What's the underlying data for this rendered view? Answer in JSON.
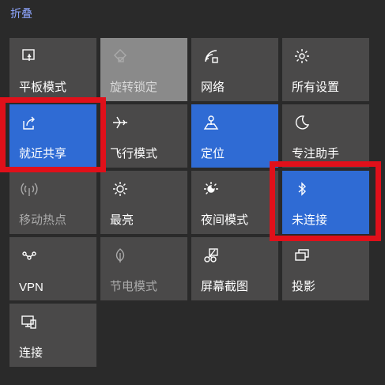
{
  "header": {
    "title": "折叠"
  },
  "tiles": [
    {
      "label": "平板模式",
      "icon": "tablet-mode-icon"
    },
    {
      "label": "旋转锁定",
      "icon": "rotation-lock-icon"
    },
    {
      "label": "网络",
      "icon": "network-icon"
    },
    {
      "label": "所有设置",
      "icon": "settings-gear-icon"
    },
    {
      "label": "就近共享",
      "icon": "nearby-share-icon"
    },
    {
      "label": "飞行模式",
      "icon": "airplane-icon"
    },
    {
      "label": "定位",
      "icon": "location-icon"
    },
    {
      "label": "专注助手",
      "icon": "moon-icon"
    },
    {
      "label": "移动热点",
      "icon": "hotspot-icon"
    },
    {
      "label": "最亮",
      "icon": "brightness-icon"
    },
    {
      "label": "夜间模式",
      "icon": "night-light-icon"
    },
    {
      "label": "未连接",
      "icon": "bluetooth-icon"
    },
    {
      "label": "VPN",
      "icon": "vpn-icon"
    },
    {
      "label": "节电模式",
      "icon": "battery-saver-icon"
    },
    {
      "label": "屏幕截图",
      "icon": "screen-snip-icon"
    },
    {
      "label": "投影",
      "icon": "project-icon"
    },
    {
      "label": "连接",
      "icon": "connect-icon"
    }
  ],
  "colors": {
    "background": "#2a2a2a",
    "tile": "#4a4949",
    "tile_active": "#2f6bd4",
    "tile_light": "#8a8a8a",
    "highlight": "#e0101a",
    "header_text": "#8ea6ff"
  }
}
